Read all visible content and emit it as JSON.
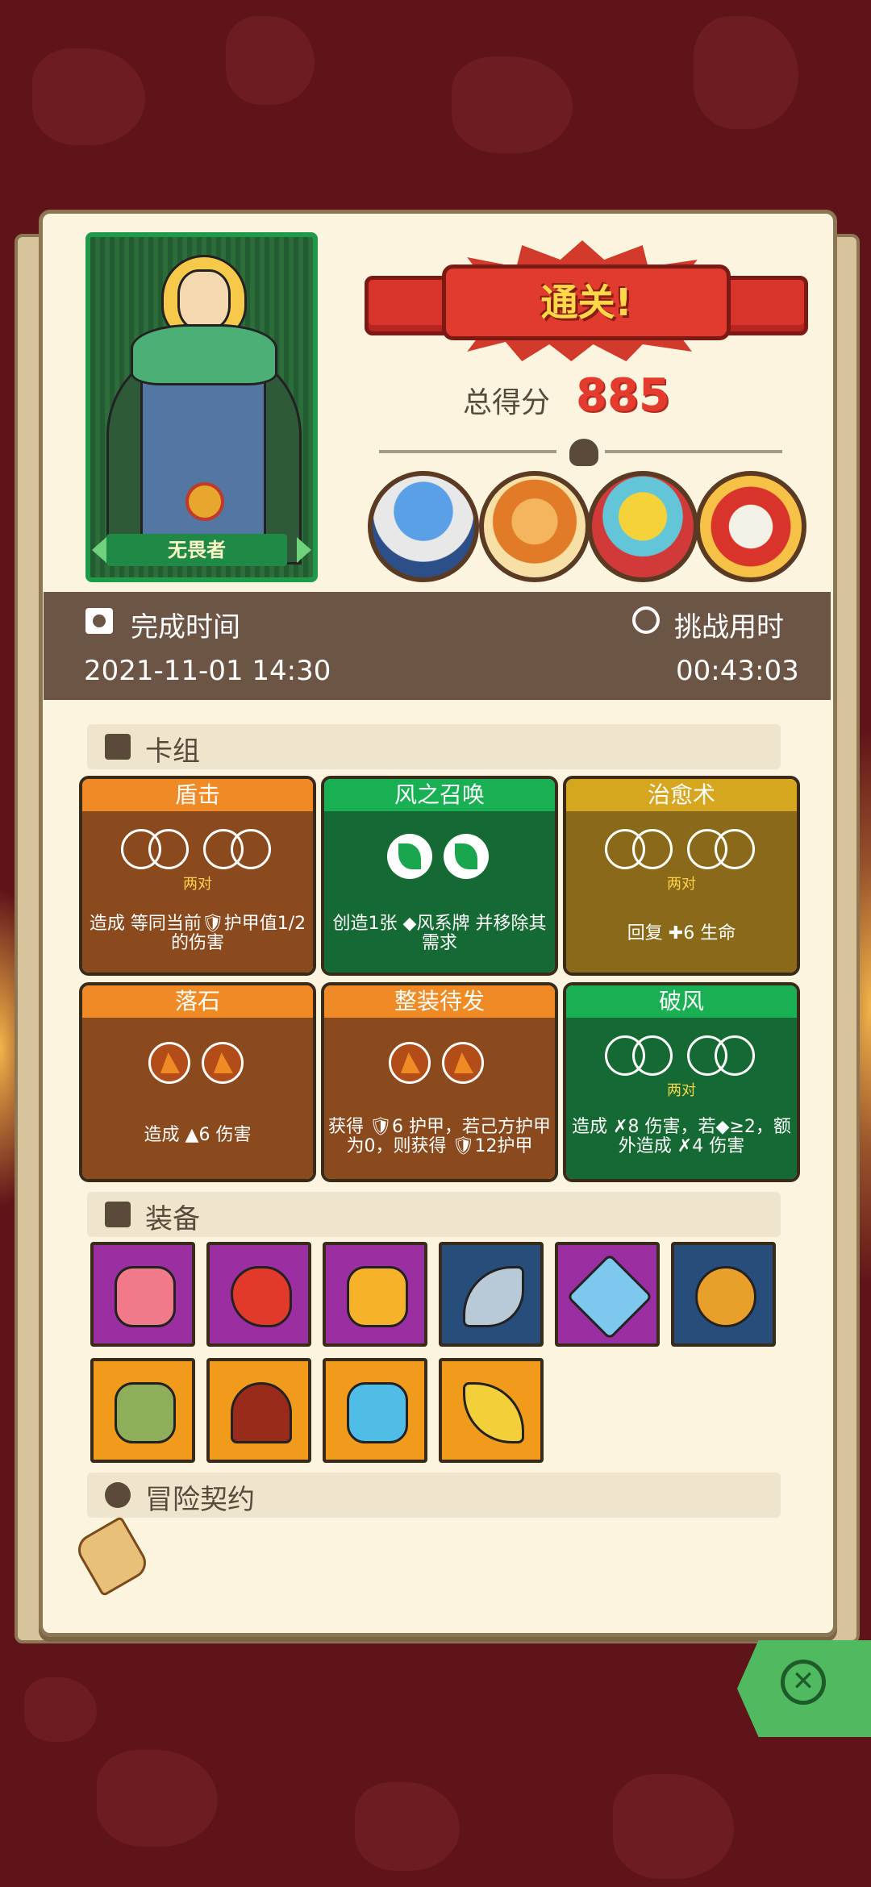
{
  "colors": {
    "background": "#5e1418",
    "paper": "#fbf4df",
    "accent_red": "#e53b2e",
    "green": "#18b052",
    "orange": "#f08a24",
    "gold": "#d7a620"
  },
  "hero": {
    "title": "无畏者"
  },
  "result": {
    "banner": "通关!",
    "score_label": "总得分",
    "score_value": "885"
  },
  "bosses": [
    {
      "icon": "mushroom-wizard-boss-icon"
    },
    {
      "icon": "horned-warrior-boss-icon"
    },
    {
      "icon": "masked-shaman-boss-icon"
    },
    {
      "icon": "demon-mask-boss-icon"
    }
  ],
  "time": {
    "finish_label": "完成时间",
    "finish_value": "2021-11-01 14:30",
    "duration_label": "挑战用时",
    "duration_value": "00:43:03"
  },
  "deck": {
    "title": "卡组",
    "cards": [
      {
        "name": "盾击",
        "req": "两对",
        "desc": "造成 等同当前🛡护甲值1/2的伤害",
        "color": "orange"
      },
      {
        "name": "风之召唤",
        "req": "",
        "desc": "创造1张 ◆风系牌 并移除其需求",
        "color": "green"
      },
      {
        "name": "治愈术",
        "req": "两对",
        "desc": "回复 ✚6 生命",
        "color": "gold"
      },
      {
        "name": "落石",
        "req": "",
        "desc": "造成 ▲6 伤害",
        "color": "orange"
      },
      {
        "name": "整装待发",
        "req": "",
        "desc": "获得 🛡6 护甲，若己方护甲为0，则获得 🛡12护甲",
        "color": "orange"
      },
      {
        "name": "破风",
        "req": "两对",
        "desc": "造成 ✗8 伤害，若◆≥2，额外造成 ✗4 伤害",
        "color": "green"
      }
    ]
  },
  "equipment": {
    "title": "装备",
    "items": [
      {
        "icon": "slime-cube-icon"
      },
      {
        "icon": "fire-pepper-icon"
      },
      {
        "icon": "flame-shield-icon"
      },
      {
        "icon": "sickle-blade-icon"
      },
      {
        "icon": "ice-dagger-icon"
      },
      {
        "icon": "golden-seed-pot-icon"
      },
      {
        "icon": "moss-book-icon"
      },
      {
        "icon": "red-hood-icon"
      },
      {
        "icon": "crystal-shield-icon"
      },
      {
        "icon": "phoenix-feather-icon"
      }
    ]
  },
  "contract": {
    "title": "冒险契约",
    "icon": "scroll-icon"
  },
  "close": {
    "icon": "close-icon"
  }
}
